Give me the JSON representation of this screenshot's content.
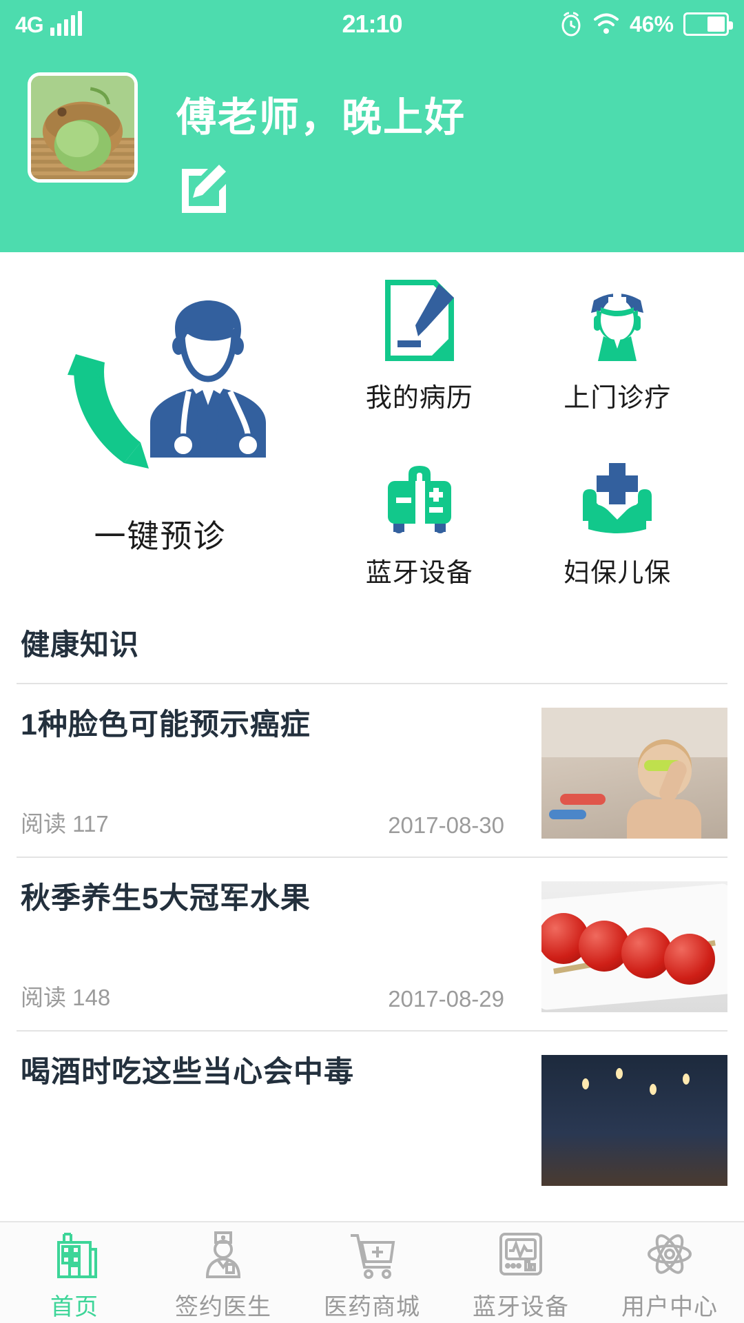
{
  "status_bar": {
    "network": "4G",
    "time": "21:10",
    "battery_percent": "46%",
    "icons": [
      "signal-bars-icon",
      "alarm-clock-icon",
      "wifi-icon",
      "battery-icon"
    ]
  },
  "header": {
    "greeting": "傅老师，晚上好",
    "avatar_alt": "matcha-ice-cream-avatar",
    "edit_icon": "edit-pencil-icon",
    "background_color": "#4DDCAE"
  },
  "quick_actions": {
    "primary": {
      "label": "一键预诊",
      "icon": "phone-doctor-icon"
    },
    "tiles": [
      {
        "label": "我的病历",
        "icon": "document-pen-icon"
      },
      {
        "label": "上门诊疗",
        "icon": "nurse-icon"
      },
      {
        "label": "蓝牙设备",
        "icon": "medical-kit-icon"
      },
      {
        "label": "妇保儿保",
        "icon": "hands-cross-icon"
      }
    ]
  },
  "health_section": {
    "title": "健康知识",
    "read_prefix": "阅读",
    "articles": [
      {
        "title": "1种脸色可能预示癌症",
        "reads": "阅读 117",
        "date": "2017-08-30",
        "thumb": "child-in-bathtub"
      },
      {
        "title": "秋季养生5大冠军水果",
        "reads": "阅读 148",
        "date": "2017-08-29",
        "thumb": "candied-haws"
      },
      {
        "title": "喝酒时吃这些当心会中毒",
        "reads": "",
        "date": "",
        "thumb": "night-scene"
      }
    ]
  },
  "bottom_nav": {
    "active_color": "#3DD598",
    "items": [
      {
        "label": "首页",
        "icon": "hospital-icon",
        "active": true
      },
      {
        "label": "签约医生",
        "icon": "doctor-icon",
        "active": false
      },
      {
        "label": "医药商城",
        "icon": "shopping-cart-icon",
        "active": false
      },
      {
        "label": "蓝牙设备",
        "icon": "monitor-icon",
        "active": false
      },
      {
        "label": "用户中心",
        "icon": "atom-icon",
        "active": false
      }
    ]
  }
}
